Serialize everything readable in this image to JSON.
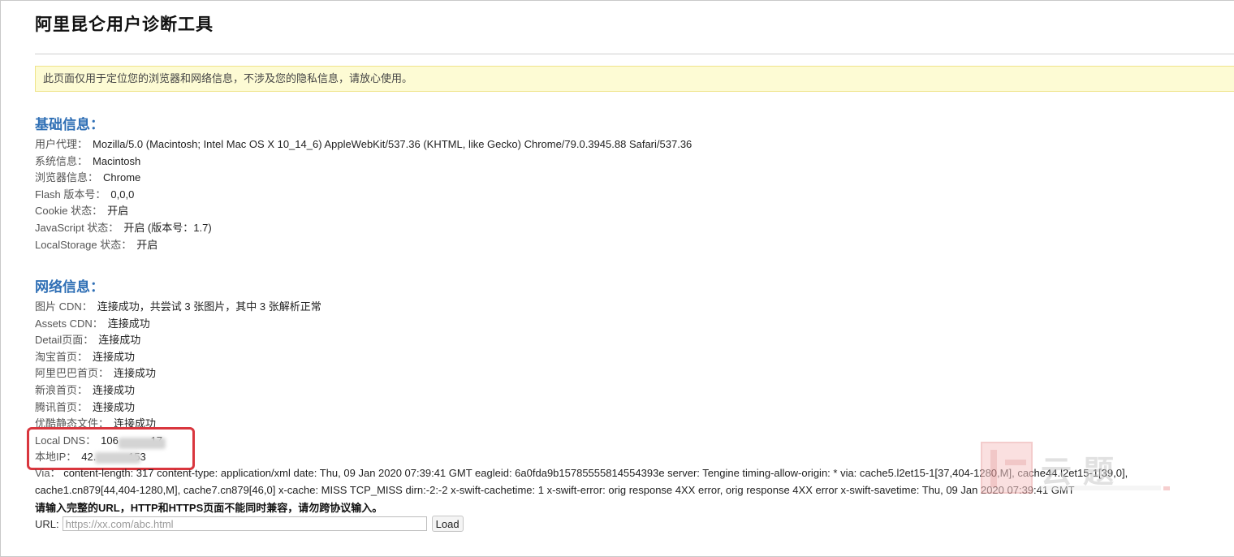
{
  "page": {
    "title": "阿里昆仑用户诊断工具",
    "notice": "此页面仅用于定位您的浏览器和网络信息，不涉及您的隐私信息，请放心使用。"
  },
  "basic": {
    "heading": "基础信息：",
    "rows": [
      {
        "label": "用户代理：",
        "value": "Mozilla/5.0 (Macintosh; Intel Mac OS X 10_14_6) AppleWebKit/537.36 (KHTML, like Gecko) Chrome/79.0.3945.88 Safari/537.36"
      },
      {
        "label": "系统信息：",
        "value": "Macintosh"
      },
      {
        "label": "浏览器信息：",
        "value": "Chrome"
      },
      {
        "label": "Flash 版本号：",
        "value": "0,0,0"
      },
      {
        "label": "Cookie 状态：",
        "value": "开启"
      },
      {
        "label": "JavaScript 状态：",
        "value": "开启 (版本号：1.7)"
      },
      {
        "label": "LocalStorage 状态：",
        "value": "开启"
      }
    ]
  },
  "network": {
    "heading": "网络信息：",
    "rows": [
      {
        "label": "图片 CDN：",
        "value": "连接成功，共尝试 3 张图片，其中 3 张解析正常"
      },
      {
        "label": "Assets CDN：",
        "value": "连接成功"
      },
      {
        "label": "Detail页面：",
        "value": "连接成功"
      },
      {
        "label": "淘宝首页：",
        "value": "连接成功"
      },
      {
        "label": "阿里巴巴首页：",
        "value": "连接成功"
      },
      {
        "label": "新浪首页：",
        "value": "连接成功"
      },
      {
        "label": "腾讯首页：",
        "value": "连接成功"
      },
      {
        "label": "优酷静态文件：",
        "value": "连接成功"
      },
      {
        "label": "Local DNS：",
        "value": "106          .17"
      },
      {
        "label": "本地IP：",
        "value": "42.          .153"
      }
    ],
    "via_label": "Via：",
    "via_value": "content-length: 317 content-type: application/xml date: Thu, 09 Jan 2020 07:39:41 GMT eagleid: 6a0fda9b15785555814554393e server: Tengine timing-allow-origin: * via: cache5.l2et15-1[37,404-1280,M], cache44.l2et15-1[39,0], cache1.cn879[44,404-1280,M], cache7.cn879[46,0] x-cache: MISS TCP_MISS dirn:-2:-2 x-swift-cachetime: 1 x-swift-error: orig response 4XX error, orig response 4XX error x-swift-savetime: Thu, 09 Jan 2020 07:39:41 GMT"
  },
  "form": {
    "warning": "请输入完整的URL，HTTP和HTTPS页面不能同时兼容，请勿跨协议输入。",
    "url_label": "URL:",
    "url_placeholder": "https://xx.com/abc.html",
    "load_label": "Load"
  },
  "watermark": {
    "text": "云题",
    "icon": "seal-stamp-icon"
  },
  "colors": {
    "heading": "#2f6fb5",
    "notice_bg": "#fdfbd4",
    "highlight": "#d9363e"
  }
}
